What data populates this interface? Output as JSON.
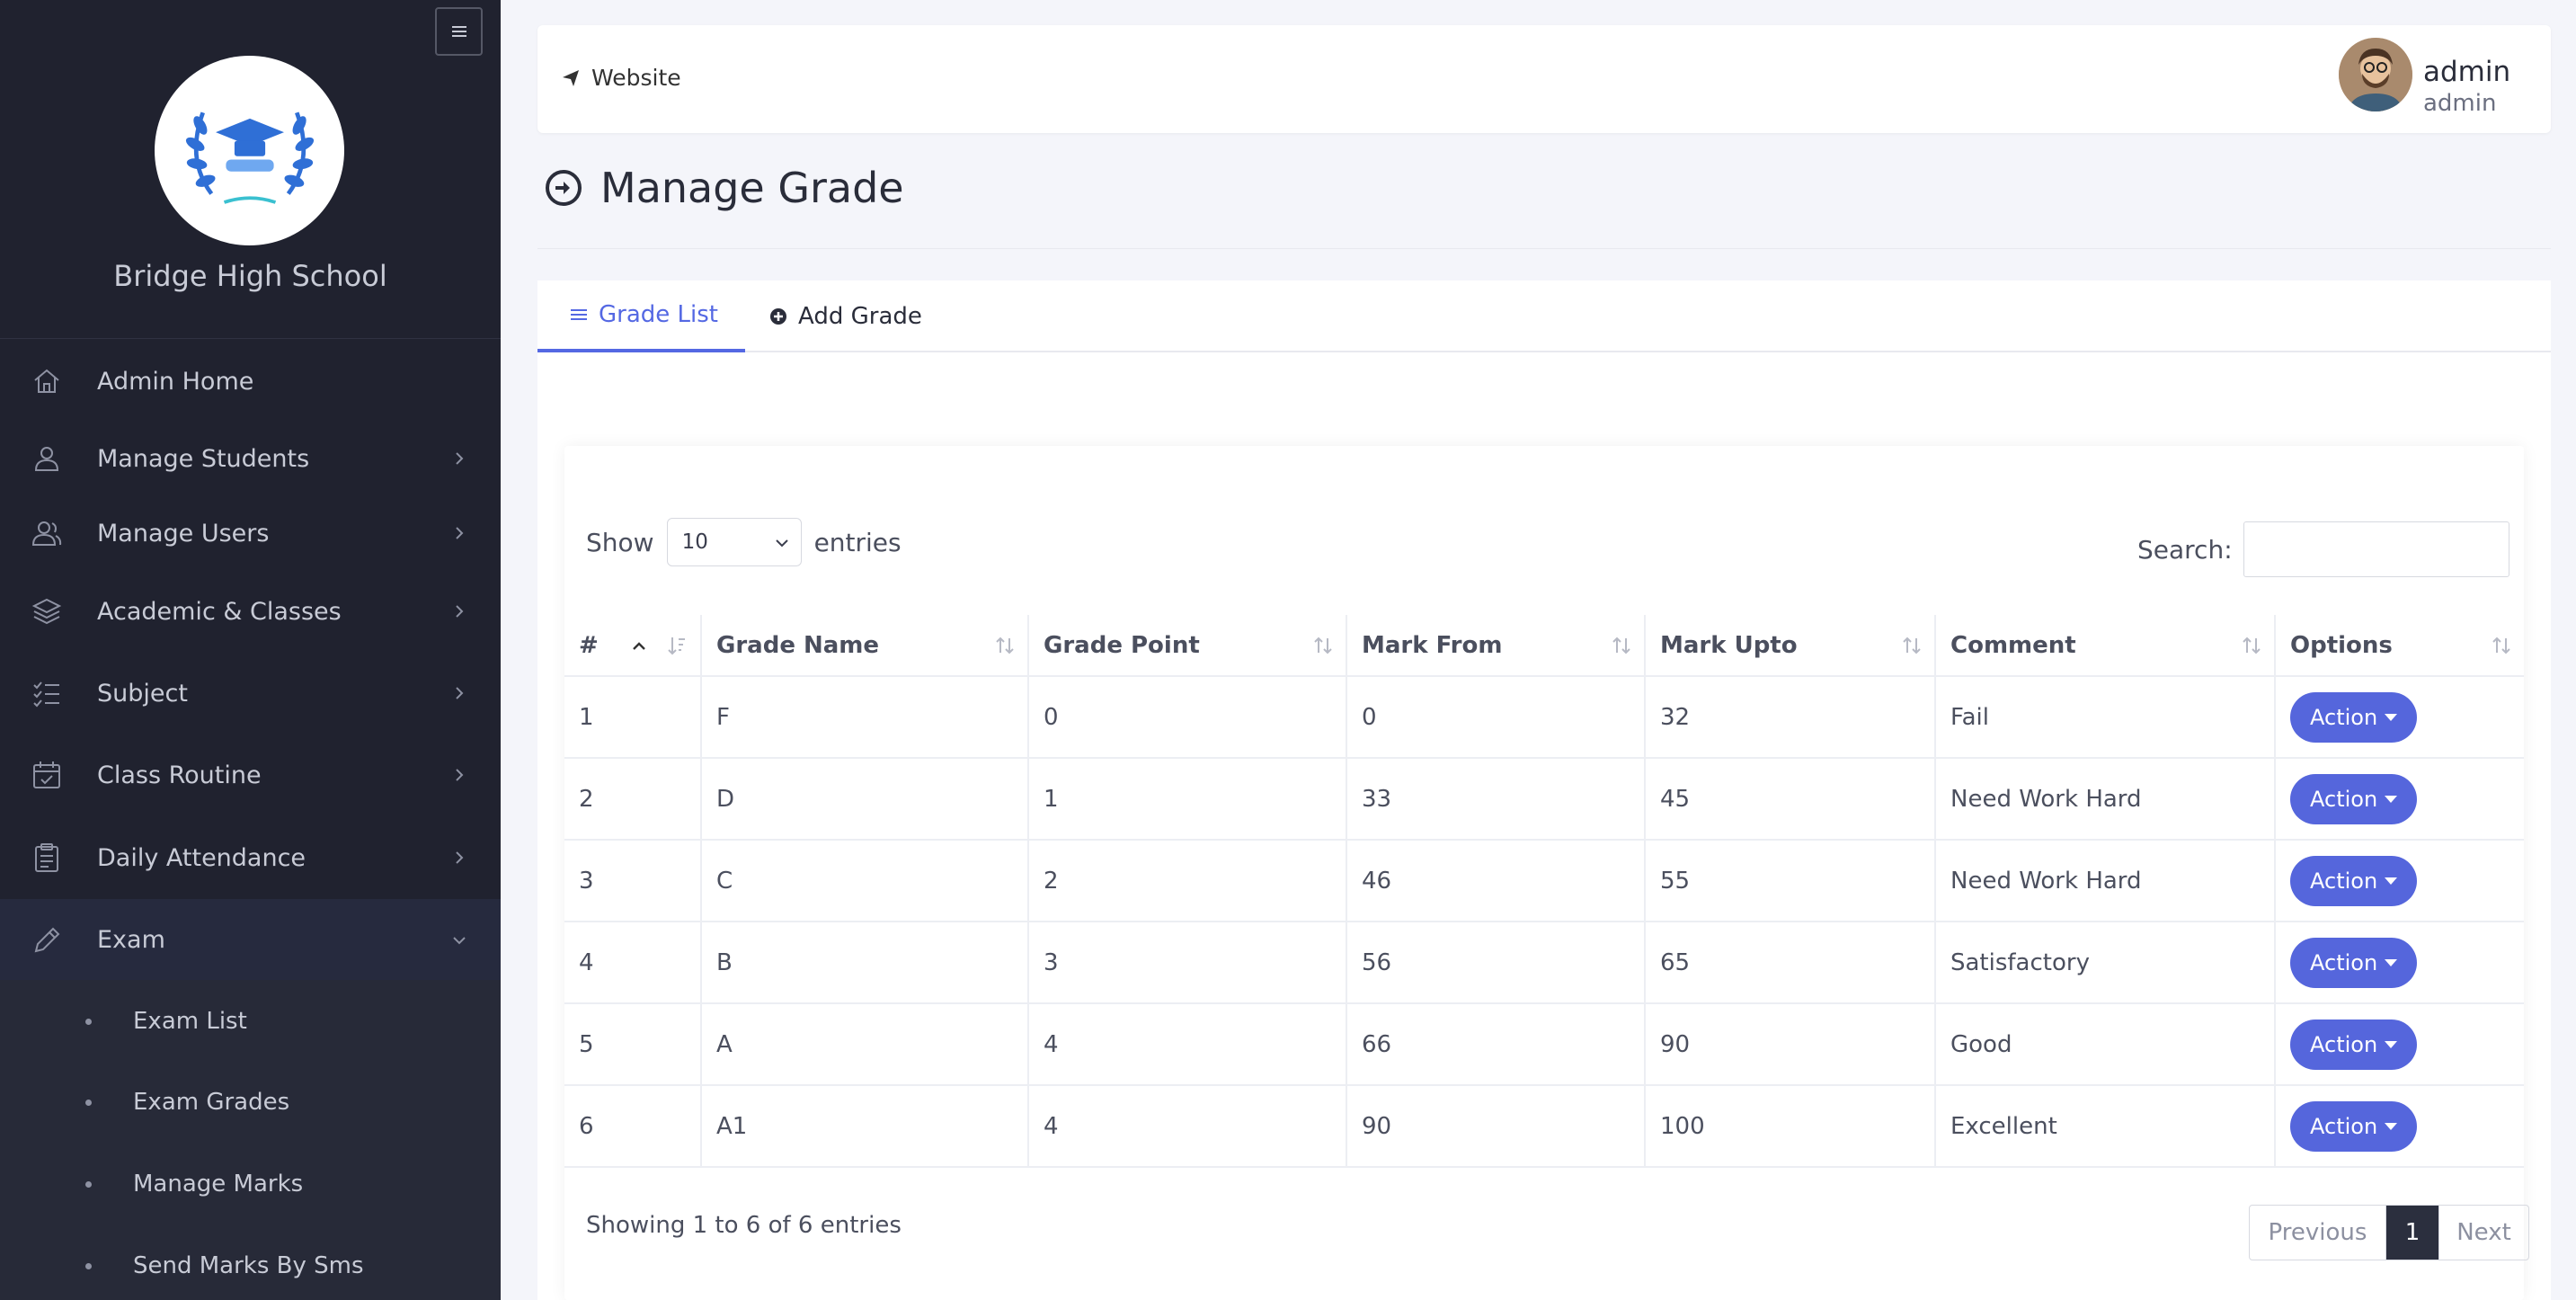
{
  "sidebar": {
    "school_name": "Bridge High School",
    "items": [
      {
        "label": "Admin Home",
        "icon": "home-icon"
      },
      {
        "label": "Manage Students",
        "icon": "user-icon"
      },
      {
        "label": "Manage Users",
        "icon": "users-icon"
      },
      {
        "label": "Academic & Classes",
        "icon": "layers-icon"
      },
      {
        "label": "Subject",
        "icon": "list-check-icon"
      },
      {
        "label": "Class Routine",
        "icon": "calendar-icon"
      },
      {
        "label": "Daily Attendance",
        "icon": "clipboard-icon"
      },
      {
        "label": "Exam",
        "icon": "pencil-icon"
      }
    ],
    "exam_submenu": [
      {
        "label": "Exam List"
      },
      {
        "label": "Exam Grades"
      },
      {
        "label": "Manage Marks"
      },
      {
        "label": "Send Marks By Sms"
      }
    ]
  },
  "topbar": {
    "website_label": "Website",
    "user_name": "admin",
    "user_role": "admin"
  },
  "page": {
    "title": "Manage Grade"
  },
  "tabs": [
    {
      "label": "Grade List",
      "active": true
    },
    {
      "label": "Add Grade",
      "active": false
    }
  ],
  "table_controls": {
    "show_label": "Show",
    "entries_value": "10",
    "entries_label": "entries",
    "search_label": "Search:",
    "search_value": ""
  },
  "table": {
    "columns": [
      "#",
      "Grade Name",
      "Grade Point",
      "Mark From",
      "Mark Upto",
      "Comment",
      "Options"
    ],
    "rows": [
      {
        "num": "1",
        "grade": "F",
        "point": "0",
        "from": "0",
        "upto": "32",
        "comment": "Fail",
        "action": "Action"
      },
      {
        "num": "2",
        "grade": "D",
        "point": "1",
        "from": "33",
        "upto": "45",
        "comment": "Need Work Hard",
        "action": "Action"
      },
      {
        "num": "3",
        "grade": "C",
        "point": "2",
        "from": "46",
        "upto": "55",
        "comment": "Need Work Hard",
        "action": "Action"
      },
      {
        "num": "4",
        "grade": "B",
        "point": "3",
        "from": "56",
        "upto": "65",
        "comment": "Satisfactory",
        "action": "Action"
      },
      {
        "num": "5",
        "grade": "A",
        "point": "4",
        "from": "66",
        "upto": "90",
        "comment": "Good",
        "action": "Action"
      },
      {
        "num": "6",
        "grade": "A1",
        "point": "4",
        "from": "90",
        "upto": "100",
        "comment": "Excellent",
        "action": "Action"
      }
    ]
  },
  "footer": {
    "info": "Showing 1 to 6 of 6 entries",
    "prev_label": "Previous",
    "current_page": "1",
    "next_label": "Next"
  },
  "colors": {
    "sidebar_bg": "#20222f",
    "accent": "#5468e3",
    "action_button": "#5566dc",
    "page_bg": "#f4f5fa"
  }
}
